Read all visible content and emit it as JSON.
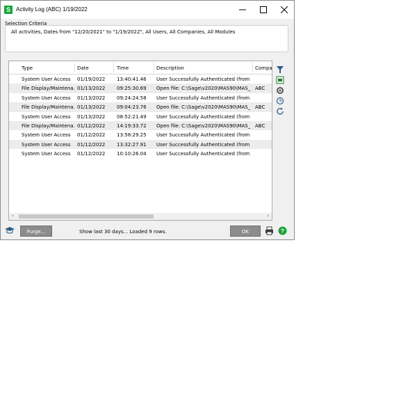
{
  "window": {
    "app_icon": "S",
    "title": "Activity Log (ABC) 1/19/2022"
  },
  "selection": {
    "label": "Selection Criteria",
    "text": "All activities, Dates from \"12/20/2021\" to \"1/19/2022\", All Users, All Companies, All Modules"
  },
  "grid": {
    "columns": [
      "Type",
      "Date",
      "Time",
      "Description",
      "Compar"
    ],
    "rows": [
      {
        "type": "System User Access",
        "date": "01/19/2022",
        "time": "13:40:41.46",
        "description": "User Successfully Authenticated (from ...",
        "company": ""
      },
      {
        "type": "File Display/Maintena...",
        "date": "01/13/2022",
        "time": "09:25:30.69",
        "description": "Open file: C:\\Sage\\v2020\\MAS90\\MAS_...",
        "company": "ABC"
      },
      {
        "type": "System User Access",
        "date": "01/13/2022",
        "time": "09:24:24.58",
        "description": "User Successfully Authenticated (from ...",
        "company": ""
      },
      {
        "type": "File Display/Maintena...",
        "date": "01/13/2022",
        "time": "09:04:23.76",
        "description": "Open file: C:\\Sage\\v2020\\MAS90\\MAS_...",
        "company": "ABC"
      },
      {
        "type": "System User Access",
        "date": "01/13/2022",
        "time": "08:52:21.49",
        "description": "User Successfully Authenticated (from ...",
        "company": ""
      },
      {
        "type": "File Display/Maintena...",
        "date": "01/12/2022",
        "time": "14:19:33.72",
        "description": "Open file: C:\\Sage\\v2020\\MAS90\\MAS_...",
        "company": "ABC"
      },
      {
        "type": "System User Access",
        "date": "01/12/2022",
        "time": "13:58:29.25",
        "description": "User Successfully Authenticated (from ...",
        "company": ""
      },
      {
        "type": "System User Access",
        "date": "01/12/2022",
        "time": "13:32:27.91",
        "description": "User Successfully Authenticated (from ...",
        "company": ""
      },
      {
        "type": "System User Access",
        "date": "01/12/2022",
        "time": "10:10:26.04",
        "description": "User Successfully Authenticated (from ...",
        "company": ""
      }
    ]
  },
  "side_tools": [
    "filter-icon",
    "export-icon",
    "settings-icon",
    "history-icon",
    "refresh-icon"
  ],
  "footer": {
    "purge_label": "Purge...",
    "status": "Show last 30 days... Loaded 9 rows.",
    "ok_label": "OK"
  },
  "colors": {
    "accent_green": "#1aa33a",
    "button_gray": "#8c8c8c",
    "alt_row": "#ececec"
  }
}
